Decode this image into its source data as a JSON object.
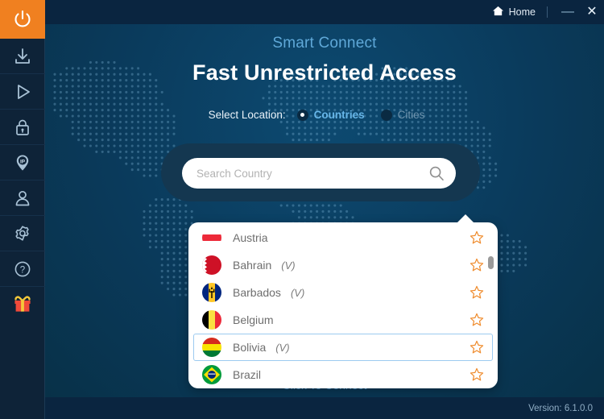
{
  "sidebar": {
    "items": [
      {
        "name": "power-button",
        "icon": "power-icon",
        "active": true
      },
      {
        "name": "download-button",
        "icon": "download-icon",
        "active": false
      },
      {
        "name": "play-button",
        "icon": "play-icon",
        "active": false
      },
      {
        "name": "lock-button",
        "icon": "lock-icon",
        "active": false
      },
      {
        "name": "ip-location-button",
        "icon": "ip-pin-icon",
        "active": false
      },
      {
        "name": "account-button",
        "icon": "user-icon",
        "active": false
      },
      {
        "name": "settings-button",
        "icon": "gear-icon",
        "active": false
      },
      {
        "name": "help-button",
        "icon": "question-icon",
        "active": false
      },
      {
        "name": "gift-button",
        "icon": "gift-icon",
        "active": false
      }
    ],
    "accent_color": "#f08020"
  },
  "titlebar": {
    "home_label": "Home",
    "home_icon": "home-icon",
    "minimize_label": "—",
    "close_label": "✕"
  },
  "main": {
    "smart_connect_label": "Smart Connect",
    "hero_title": "Fast Unrestricted Access",
    "select_location_label": "Select Location:",
    "options": [
      {
        "label": "Countries",
        "selected": true
      },
      {
        "label": "Cities",
        "selected": false
      }
    ],
    "click_to_connect_label": "Click To Connect"
  },
  "search": {
    "value": "",
    "placeholder": "Search Country",
    "icon": "search-icon"
  },
  "dropdown": {
    "scrollbar_visible": true,
    "rows": [
      {
        "country": "Austria",
        "virtual": "",
        "flag": "austria",
        "selected": false,
        "favorite": false
      },
      {
        "country": "Bahrain",
        "virtual": "(V)",
        "flag": "bahrain",
        "selected": false,
        "favorite": false
      },
      {
        "country": "Barbados",
        "virtual": "(V)",
        "flag": "barbados",
        "selected": false,
        "favorite": false
      },
      {
        "country": "Belgium",
        "virtual": "",
        "flag": "belgium",
        "selected": false,
        "favorite": false
      },
      {
        "country": "Bolivia",
        "virtual": "(V)",
        "flag": "bolivia",
        "selected": true,
        "favorite": false
      },
      {
        "country": "Brazil",
        "virtual": "",
        "flag": "brazil",
        "selected": false,
        "favorite": false
      }
    ],
    "star_icon": "star-outline-icon",
    "star_color": "#ef8b2c",
    "selected_border_color": "#9ccaf0"
  },
  "footer": {
    "version_label": "Version:  6.1.0.0"
  },
  "colors": {
    "titlebar_bg": "#0a2540",
    "main_bg": "#0b4064",
    "sidebar_bg": "#0e2338",
    "search_shell_bg": "#143750",
    "accent_orange": "#f08020",
    "link_blue": "#4b8fc0",
    "heading_blue": "#5fa8d8"
  }
}
